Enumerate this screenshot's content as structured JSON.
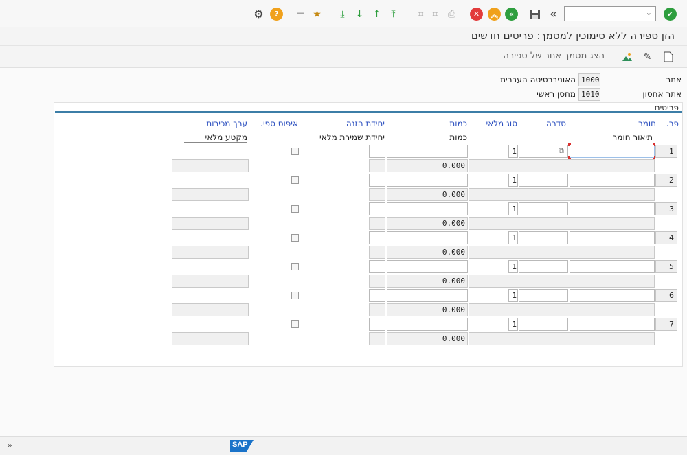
{
  "toolbar": {
    "command_value": "",
    "icons": [
      "check-icon",
      "save-icon",
      "back-icon",
      "exit-icon",
      "cancel-icon",
      "print-icon",
      "find-icon",
      "find-next-icon",
      "first-page-icon",
      "prev-page-icon",
      "next-page-icon",
      "last-page-icon",
      "new-session-icon",
      "shortcut-icon",
      "help-icon",
      "settings-icon"
    ]
  },
  "title": "הזן ספירה ללא סימוכין למסמך: פריטים חדשים",
  "app_toolbar": {
    "show_other_count": "הצג מסמך אחר של ספירה"
  },
  "header": {
    "plant_label": "אתר",
    "plant_code": "1000",
    "plant_name": "האוניברסיטה העברית",
    "sloc_label": "אתר אחסון",
    "sloc_code": "1010",
    "sloc_name": "מחסן ראשי"
  },
  "items_section": {
    "title": "פריטים",
    "headers": {
      "item": "פר.",
      "material": "חומר",
      "batch": "סדרה",
      "stock_type": "סוג מלאי",
      "quantity": "כמות",
      "entry_unit": "יחידת הזנה",
      "zero_count": "איפוס ספי.",
      "sales_value": "ערך מכירות"
    },
    "subheaders": {
      "material_desc": "תיאור חומר",
      "quantity": "כמות",
      "stock_unit": "יחידת שמירת מלאי",
      "stock_segment": "מקטע מלאי"
    },
    "rows": [
      {
        "item": "1",
        "stock_type": "1",
        "quantity": "0.000"
      },
      {
        "item": "2",
        "stock_type": "1",
        "quantity": "0.000"
      },
      {
        "item": "3",
        "stock_type": "1",
        "quantity": "0.000"
      },
      {
        "item": "4",
        "stock_type": "1",
        "quantity": "0.000"
      },
      {
        "item": "5",
        "stock_type": "1",
        "quantity": "0.000"
      },
      {
        "item": "6",
        "stock_type": "1",
        "quantity": "0.000"
      },
      {
        "item": "7",
        "stock_type": "1",
        "quantity": "0.000"
      }
    ]
  },
  "footer": {
    "logo": "SAP",
    "expand": "«"
  }
}
